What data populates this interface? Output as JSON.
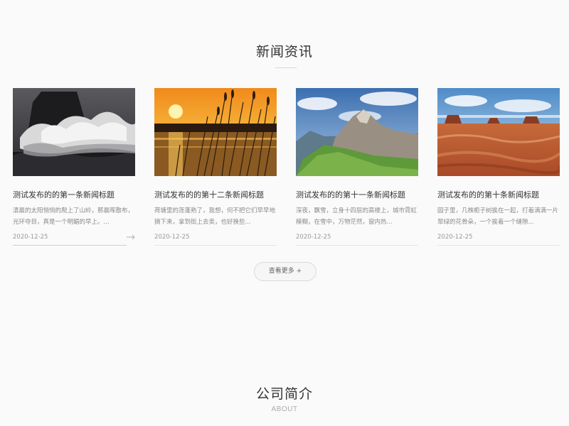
{
  "news": {
    "title": "新闻资讯",
    "more_label": "查看更多 +",
    "items": [
      {
        "title": "测试发布的的第一条新闻标题",
        "summary": "清晨的太阳悄悄的爬上了山岭，那晨晖散布，光环夺目，真是一个明媚的早上。...",
        "date": "2020-12-25",
        "image": "ocean-wave"
      },
      {
        "title": "测试发布的的第十二条新闻标题",
        "summary": "荷塘里的莲蓬熟了，我想，何不把它们早早地摘下来，拿到街上去卖，也好换些...",
        "date": "2020-12-25",
        "image": "sunset-reeds"
      },
      {
        "title": "测试发布的的第十一条新闻标题",
        "summary": "深夜，飘雪，立身十四层的高楼上，城市霓虹模糊，在雪中，万物茫然，窗内热...",
        "date": "2020-12-25",
        "image": "mountain-peaks"
      },
      {
        "title": "测试发布的的第十条新闻标题",
        "summary": "园子里，几株栀子树挨在一起，打着满满一片翠绿的花骨朵，一个挨着一个缝隙...",
        "date": "2020-12-25",
        "image": "desert-canyon"
      }
    ]
  },
  "about": {
    "title": "公司简介",
    "subtitle": "ABOUT"
  }
}
